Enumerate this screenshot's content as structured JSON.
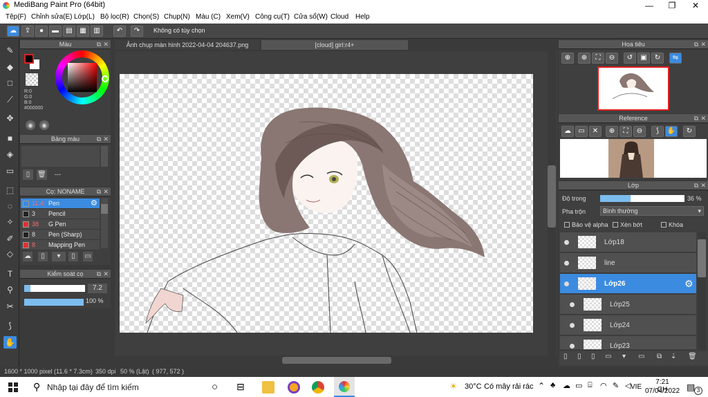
{
  "window": {
    "title": "MediBang Paint Pro (64bit)",
    "minimize": "—",
    "maximize": "❐",
    "close": "✕"
  },
  "menu": [
    "Tệp(F)",
    "Chỉnh sửa(E)",
    "Lớp(L)",
    "Bộ lọc(R)",
    "Chọn(S)",
    "Chụp(N)",
    "Màu (C)",
    "Xem(V)",
    "Công cụ(T)",
    "Cửa sổ(W)",
    "Cloud",
    "Help"
  ],
  "toolbar": {
    "option_label": "Không có tùy chọn"
  },
  "color_panel": {
    "title": "Màu",
    "r": "R:0",
    "g": "G:0",
    "b": "B:0",
    "hex": "#000000",
    "fg_color": "#000000",
    "bg_color": "#ffffff"
  },
  "palette_panel": {
    "title": "Bảng màu",
    "none": "---"
  },
  "brush_panel": {
    "title": "Cọ: NONAME",
    "items": [
      {
        "size": "11.4",
        "name": "Pen",
        "color": "#3b8be0",
        "selected": true
      },
      {
        "size": "3",
        "name": "Pencil",
        "color": "#222222",
        "selected": false
      },
      {
        "size": "38",
        "name": "G Pen",
        "color": "#e03030",
        "selected": false
      },
      {
        "size": "8",
        "name": "Pen (Sharp)",
        "color": "#222222",
        "selected": false
      },
      {
        "size": "8",
        "name": "Mapping Pen",
        "color": "#e03030",
        "selected": false
      }
    ]
  },
  "brush_control": {
    "title": "Kiểm soát cọ",
    "size": "7.2",
    "opacity": "100 %",
    "size_fraction": 0.1,
    "opacity_fraction": 1.0
  },
  "tabs": [
    {
      "label": "Ảnh chụp màn hình 2022-04-04 204637.png"
    },
    {
      "label": "[cloud] girl:r4+"
    }
  ],
  "navigator": {
    "title": "Hoa tiêu"
  },
  "reference": {
    "title": "Reference"
  },
  "layer_panel": {
    "title": "Lớp",
    "opacity_label": "Độ trong",
    "opacity_value": "36 %",
    "opacity_fraction": 0.36,
    "blend_label": "Pha trộn",
    "blend_value": "Bình thường",
    "protect_alpha": "Bảo vệ alpha",
    "clip": "Xén bớt",
    "lock": "Khóa",
    "layers": [
      {
        "name": "Lớp18",
        "selected": false
      },
      {
        "name": "line",
        "selected": false
      },
      {
        "name": "Lớp26",
        "selected": true
      },
      {
        "name": "Lớp25",
        "selected": false
      },
      {
        "name": "Lớp24",
        "selected": false
      },
      {
        "name": "Lớp23",
        "selected": false
      }
    ]
  },
  "status": {
    "size": "1600 * 1000 pixel",
    "cm": "(11.6 * 7.3cm)",
    "dpi": "350 dpi",
    "zoom": "50 % (Lật)",
    "coords": "( 977, 572 )"
  },
  "taskbar": {
    "search_placeholder": "Nhập tại đây để tìm kiếm",
    "weather_temp": "30°C",
    "weather_text": "Có mây rải rác",
    "lang": "VIE",
    "time": "7:21 CH",
    "date": "07/04/2022",
    "notif_count": "3"
  }
}
